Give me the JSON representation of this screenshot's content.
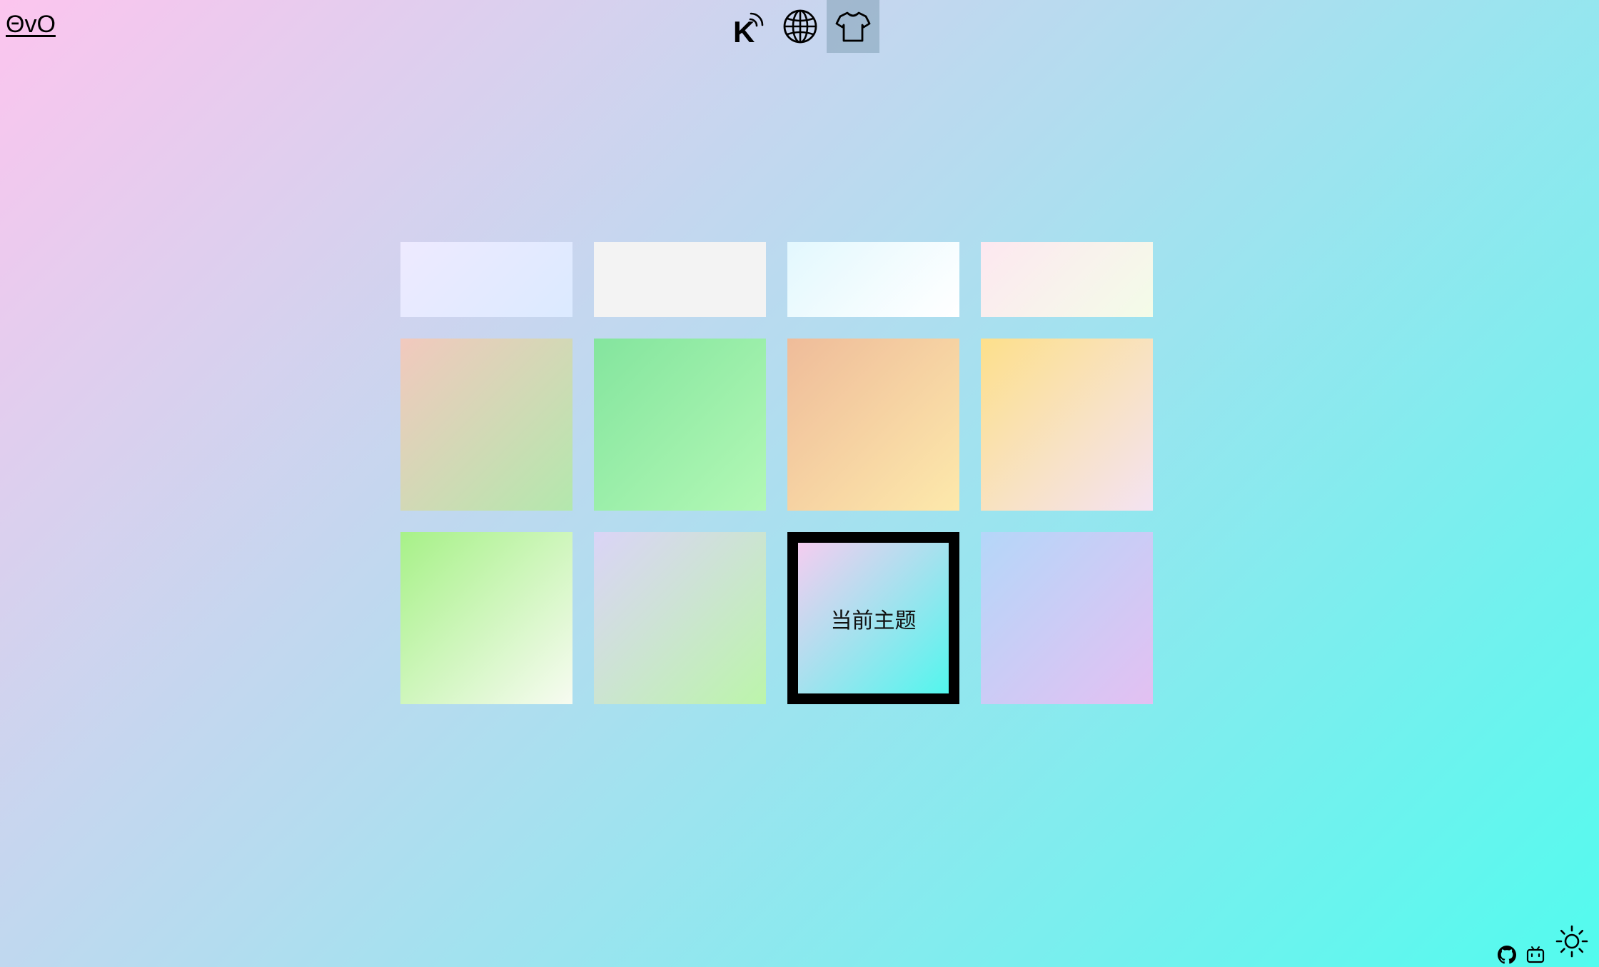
{
  "header": {
    "logo_text": "ΘvO",
    "nav": [
      {
        "icon": "k-signal-icon",
        "active": false
      },
      {
        "icon": "globe-icon",
        "active": false
      },
      {
        "icon": "tshirt-icon",
        "active": true
      }
    ]
  },
  "themes": {
    "current_label": "当前主题",
    "swatches": [
      {
        "gradient": [
          "#eeeaff",
          "#dbeaff"
        ],
        "current": false
      },
      {
        "gradient": [
          "#f3f3f3",
          "#f3f3f3"
        ],
        "current": false
      },
      {
        "gradient": [
          "#e3f8fe",
          "#ffffff"
        ],
        "current": false
      },
      {
        "gradient": [
          "#fde8f0",
          "#f3fce8"
        ],
        "current": false
      },
      {
        "gradient": [
          "#f2c9be",
          "#b3e8ad"
        ],
        "current": false
      },
      {
        "gradient": [
          "#84e59e",
          "#b2f8b5"
        ],
        "current": false
      },
      {
        "gradient": [
          "#efbc9a",
          "#fde9ab"
        ],
        "current": false
      },
      {
        "gradient": [
          "#fde08b",
          "#f4e3f2"
        ],
        "current": false
      },
      {
        "gradient": [
          "#a7f188",
          "#f7fbf1"
        ],
        "current": false
      },
      {
        "gradient": [
          "#dbd4f7",
          "#bcf5ab"
        ],
        "current": false
      },
      {
        "gradient": [
          "#f5cdf0",
          "#52f6ed"
        ],
        "current": true
      },
      {
        "gradient": [
          "#b5d7f9",
          "#e3c0f2"
        ],
        "current": false
      }
    ]
  },
  "footer": {
    "icons": [
      "github-icon",
      "bilibili-icon",
      "sun-icon"
    ]
  }
}
